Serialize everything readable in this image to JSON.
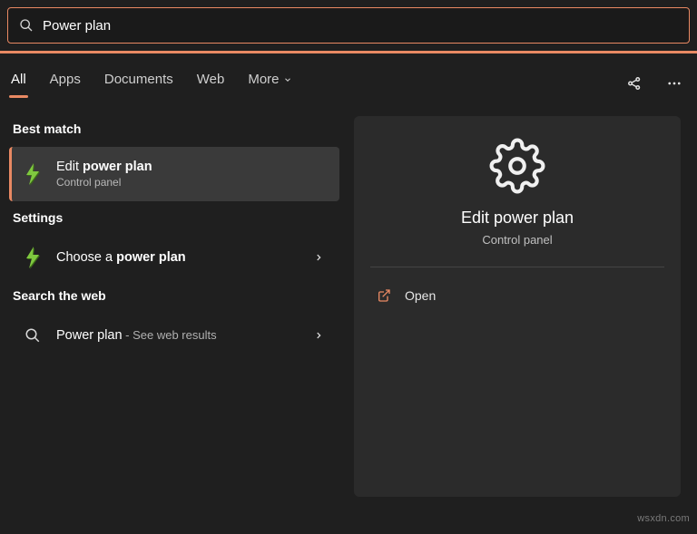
{
  "search": {
    "value": "Power plan"
  },
  "tabs": {
    "items": [
      "All",
      "Apps",
      "Documents",
      "Web",
      "More"
    ],
    "active": 0
  },
  "sections": {
    "best_match": "Best match",
    "settings": "Settings",
    "search_web": "Search the web"
  },
  "results": {
    "best": {
      "title_pre": "Edit ",
      "title_bold": "power plan",
      "subtitle": "Control panel"
    },
    "settings_item": {
      "title_pre": "Choose a ",
      "title_bold": "power plan"
    },
    "web_item": {
      "title": "Power plan",
      "suffix": " - See web results"
    }
  },
  "preview": {
    "title": "Edit power plan",
    "subtitle": "Control panel",
    "actions": {
      "open": "Open"
    }
  },
  "watermark": "wsxdn.com"
}
